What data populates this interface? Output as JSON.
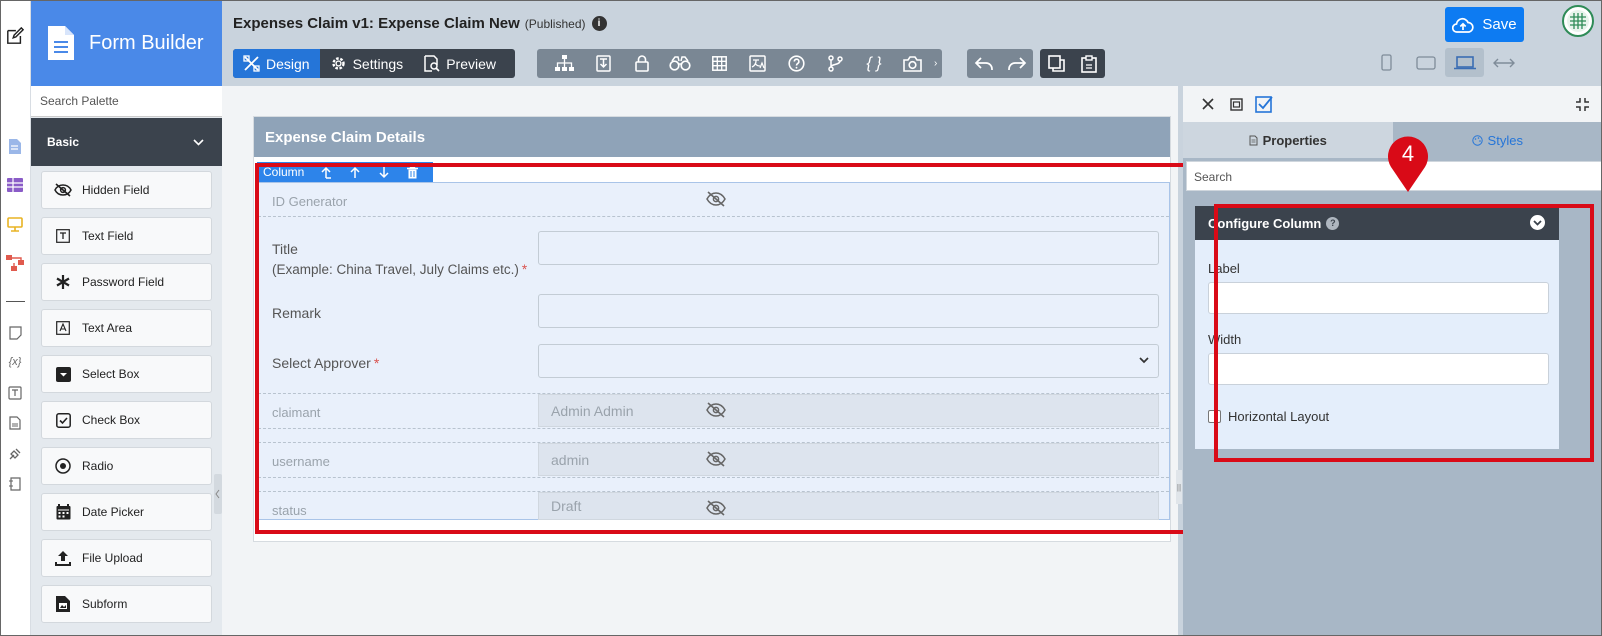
{
  "palette": {
    "brand_title": "Form Builder",
    "search_placeholder": "Search Palette",
    "group_label": "Basic",
    "items": [
      {
        "label": "Hidden Field",
        "icon": "eye-slash-icon"
      },
      {
        "label": "Text Field",
        "icon": "text-field-icon"
      },
      {
        "label": "Password Field",
        "icon": "asterisk-icon"
      },
      {
        "label": "Text Area",
        "icon": "text-area-icon"
      },
      {
        "label": "Select Box",
        "icon": "select-box-icon"
      },
      {
        "label": "Check Box",
        "icon": "checkbox-icon"
      },
      {
        "label": "Radio",
        "icon": "radio-icon"
      },
      {
        "label": "Date Picker",
        "icon": "calendar-icon"
      },
      {
        "label": "File Upload",
        "icon": "upload-icon"
      },
      {
        "label": "Subform",
        "icon": "subform-icon"
      }
    ]
  },
  "header": {
    "title": "Expenses Claim v1: Expense Claim New",
    "status": "(Published)",
    "modes": [
      "Design",
      "Settings",
      "Preview"
    ],
    "save_label": "Save"
  },
  "form": {
    "section_title": "Expense Claim Details",
    "column_label": "Column",
    "fields": {
      "id_generator": "ID Generator",
      "title_label": "Title",
      "title_hint": "(Example: China Travel, July Claims etc.)",
      "remark_label": "Remark",
      "approver_label": "Select Approver",
      "required_mark": "*",
      "claimant_label": "claimant",
      "claimant_value": "Admin Admin",
      "username_label": "username",
      "username_value": "admin",
      "status_label": "status",
      "status_value": "Draft"
    }
  },
  "properties": {
    "tab_properties": "Properties",
    "tab_styles": "Styles",
    "search_placeholder": "Search",
    "panel_title": "Configure Column",
    "label_field": "Label",
    "width_field": "Width",
    "horizontal_layout": "Horizontal Layout",
    "callout_number": "4"
  },
  "colors": {
    "accent": "#2575d8",
    "brand": "#4a89e8",
    "highlight": "#d90a17"
  }
}
